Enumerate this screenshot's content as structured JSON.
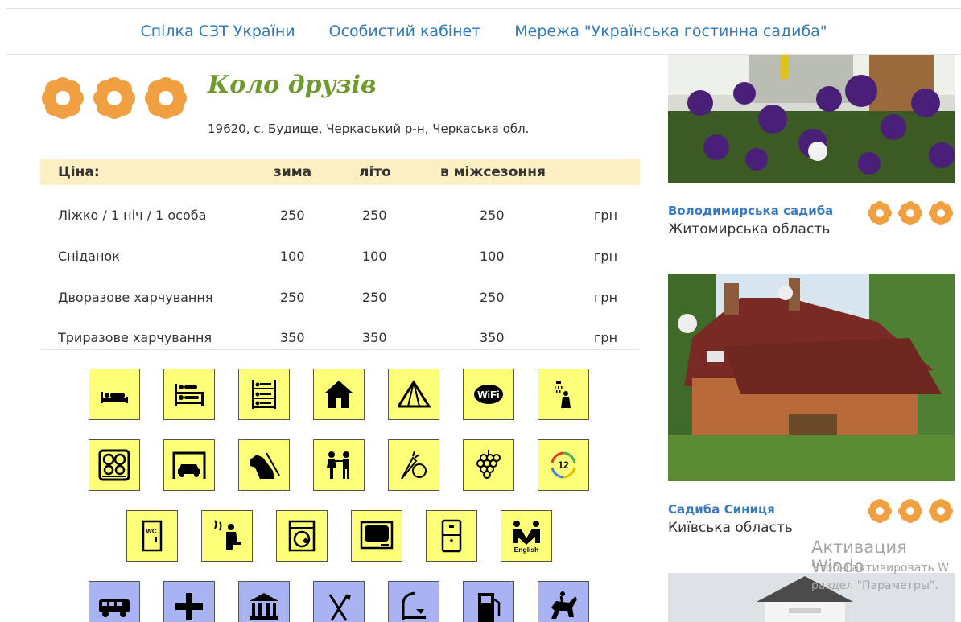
{
  "nav": {
    "items": [
      "Спілка СЗТ України",
      "Особистий кабінет",
      "Мережа \"Українська гостинна садиба\""
    ]
  },
  "listing": {
    "title": "Коло друзів",
    "address": "19620, с. Будище, Черкаський р-н, Черкаська обл.",
    "rating": 3
  },
  "prices": {
    "headers": [
      "Ціна:",
      "зима",
      "літо",
      "в міжсезоння"
    ],
    "rows": [
      {
        "label": "Ліжко / 1 ніч / 1 особа",
        "winter": "250",
        "summer": "250",
        "offseason": "250",
        "unit": "грн"
      },
      {
        "label": "Сніданок",
        "winter": "100",
        "summer": "100",
        "offseason": "100",
        "unit": "грн"
      },
      {
        "label": "Дворазове харчування",
        "winter": "250",
        "summer": "250",
        "offseason": "250",
        "unit": "грн"
      },
      {
        "label": "Триразове харчування",
        "winter": "350",
        "summer": "350",
        "offseason": "350",
        "unit": "грн"
      }
    ]
  },
  "amenities": {
    "row1": [
      "single-bed-icon",
      "double-bed-icon",
      "bunk-bed-icon",
      "house-icon",
      "tent-icon",
      "wifi-icon",
      "shower-icon"
    ],
    "row2": [
      "stove-icon",
      "garage-icon",
      "hunting-dog-icon",
      "children-icon",
      "vegetables-icon",
      "grapes-icon",
      "year-round-icon"
    ],
    "row3": [
      "wc-icon",
      "sauna-icon",
      "washing-machine-icon",
      "tv-icon",
      "fridge-icon",
      "english-icon"
    ],
    "row3_english_label": "English",
    "row3_wifi_label": "WiFi",
    "row2_year_label": "12",
    "row3_wc_label": "WC",
    "row4": [
      "bus-icon",
      "medical-cross-icon",
      "museum-icon",
      "restaurant-icon",
      "fishing-icon",
      "fuel-icon",
      "horse-riding-icon"
    ]
  },
  "sidebar": {
    "cards": [
      {
        "name": "Володимирська садиба",
        "region": "Житомирська область",
        "rating": 3
      },
      {
        "name": "Садиба Синиця",
        "region": "Київська область",
        "rating": 3
      }
    ]
  },
  "watermark": {
    "title": "Активация Windo",
    "line1": "Чтобы активировать W",
    "line2": "раздел \"Параметры\"."
  },
  "colors": {
    "accent_link": "#2e7bbf",
    "flower": "#f0a040",
    "title_green": "#6f9a2e",
    "price_header_bg": "#fdefc4",
    "amenity_yellow": "#fdff78",
    "amenity_blue": "#a9b3f4"
  }
}
